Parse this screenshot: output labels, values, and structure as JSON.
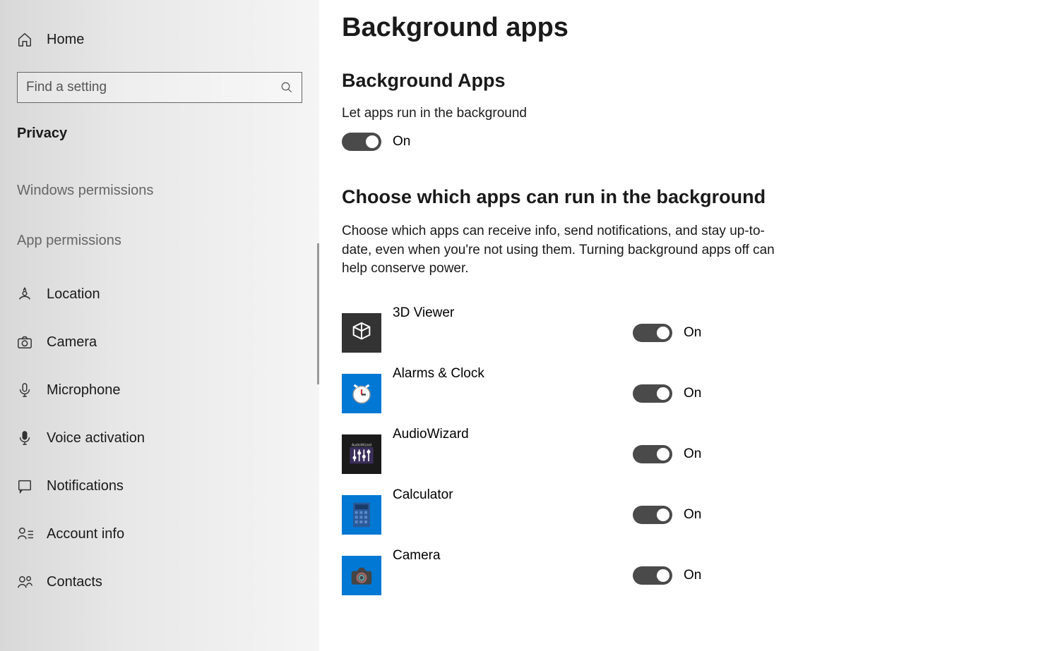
{
  "sidebar": {
    "home_label": "Home",
    "search_placeholder": "Find a setting",
    "category": "Privacy",
    "group_windows": "Windows permissions",
    "group_app": "App permissions",
    "items": [
      {
        "label": "Location",
        "icon": "location-icon"
      },
      {
        "label": "Camera",
        "icon": "camera-icon"
      },
      {
        "label": "Microphone",
        "icon": "microphone-icon"
      },
      {
        "label": "Voice activation",
        "icon": "voice-activation-icon"
      },
      {
        "label": "Notifications",
        "icon": "notifications-icon"
      },
      {
        "label": "Account info",
        "icon": "account-info-icon"
      },
      {
        "label": "Contacts",
        "icon": "contacts-icon"
      }
    ]
  },
  "main": {
    "title": "Background apps",
    "section1_title": "Background Apps",
    "master_label": "Let apps run in the background",
    "master_state": "On",
    "section2_title": "Choose which apps can run in the background",
    "section2_desc": "Choose which apps can receive info, send notifications, and stay up-to-date, even when you're not using them. Turning background apps off can help conserve power.",
    "apps": [
      {
        "name": "3D Viewer",
        "state": "On",
        "icon": "3d"
      },
      {
        "name": "Alarms & Clock",
        "state": "On",
        "icon": "clock"
      },
      {
        "name": "AudioWizard",
        "state": "On",
        "icon": "audio"
      },
      {
        "name": "Calculator",
        "state": "On",
        "icon": "calculator"
      },
      {
        "name": "Camera",
        "state": "On",
        "icon": "camera-app"
      }
    ]
  }
}
